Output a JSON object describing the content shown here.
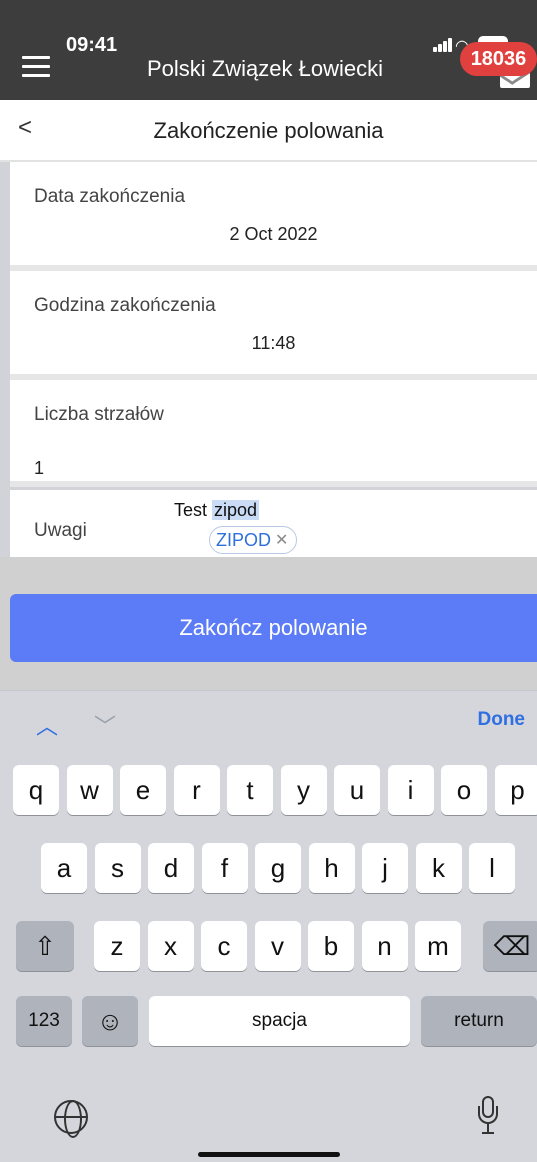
{
  "status": {
    "time": "09:41",
    "badge_count": "18036"
  },
  "app": {
    "title": "Polski Związek Łowiecki"
  },
  "header": {
    "back_glyph": "<",
    "title": "Zakończenie polowania"
  },
  "form": {
    "end_date": {
      "label": "Data zakończenia",
      "value": "2 Oct 2022"
    },
    "end_time": {
      "label": "Godzina zakończenia",
      "value": "11:48"
    },
    "shots": {
      "label": "Liczba strzałów",
      "value": "1"
    },
    "notes": {
      "label": "Uwagi",
      "text_prefix": "Test",
      "text_selected": "zipod",
      "autocorrect": "ZIPOD"
    }
  },
  "submit_label": "Zakończ polowanie",
  "keyboard": {
    "done_label": "Done",
    "row1": [
      "q",
      "w",
      "e",
      "r",
      "t",
      "y",
      "u",
      "i",
      "o",
      "p"
    ],
    "row2": [
      "a",
      "s",
      "d",
      "f",
      "g",
      "h",
      "j",
      "k",
      "l"
    ],
    "row3": [
      "z",
      "x",
      "c",
      "v",
      "b",
      "n",
      "m"
    ],
    "numbers_label": "123",
    "space_label": "spacja",
    "return_label": "return"
  },
  "colors": {
    "accent": "#5b7cf6",
    "badge": "#e0413e",
    "topbar": "#3d3d3d"
  }
}
